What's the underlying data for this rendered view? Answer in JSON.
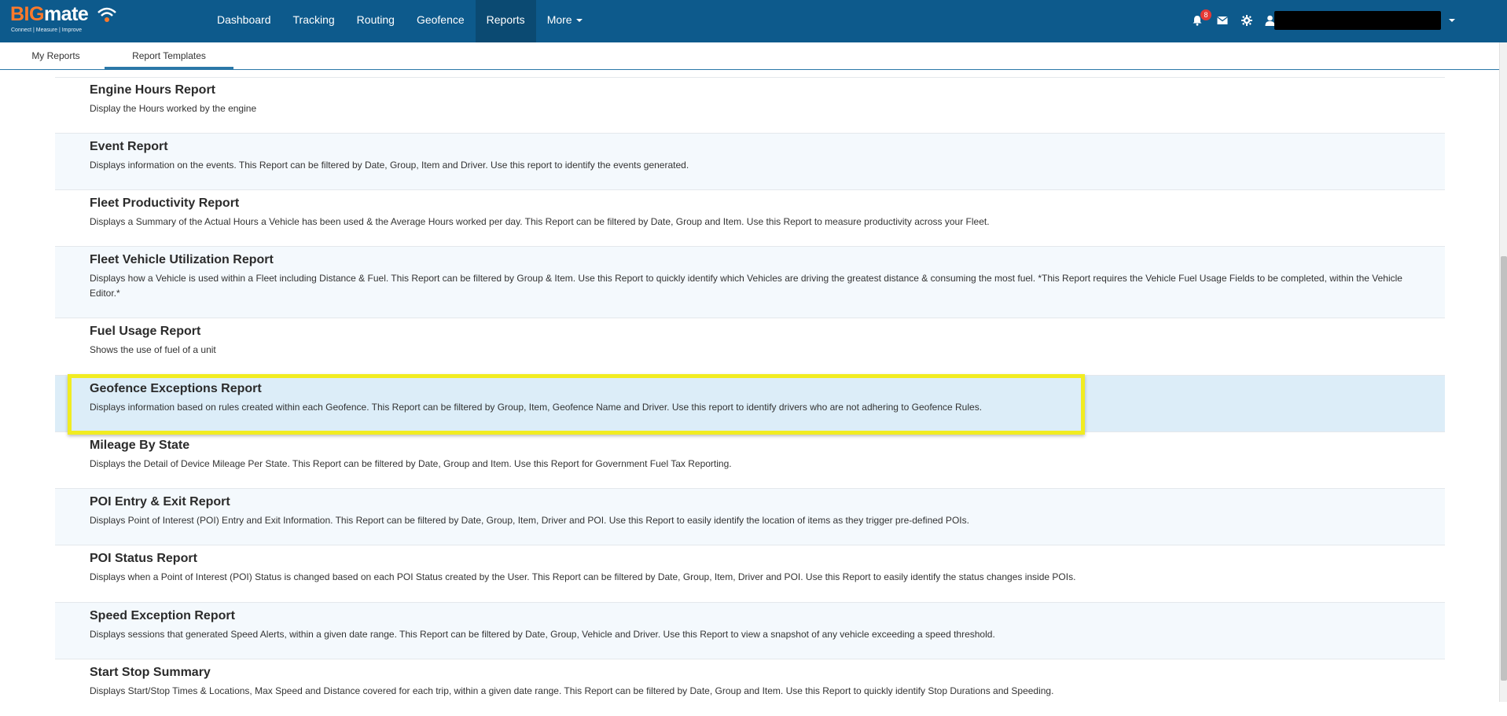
{
  "brand": {
    "logo_big": "BIG",
    "logo_mate": "mate",
    "tagline": "Connect | Measure | Improve"
  },
  "nav": {
    "items": [
      "Dashboard",
      "Tracking",
      "Routing",
      "Geofence",
      "Reports",
      "More"
    ],
    "active": "Reports",
    "notification_count": "8"
  },
  "subtabs": {
    "my_reports": "My Reports",
    "report_templates": "Report Templates",
    "active": "Report Templates"
  },
  "reports": [
    {
      "title": "Engine Hours Report",
      "desc": "Display the Hours worked by the engine"
    },
    {
      "title": "Event Report",
      "desc": "Displays information on the events. This Report can be filtered by Date, Group, Item and Driver. Use this report to identify the events generated."
    },
    {
      "title": "Fleet Productivity Report",
      "desc": "Displays a Summary of the Actual Hours a Vehicle has been used & the Average Hours worked per day. This Report can be filtered by Date, Group and Item. Use this Report to measure productivity across your Fleet."
    },
    {
      "title": "Fleet Vehicle Utilization Report",
      "desc": "Displays how a Vehicle is used within a Fleet including Distance & Fuel. This Report can be filtered by Group & Item. Use this Report to quickly identify which Vehicles are driving the greatest distance & consuming the most fuel. *This Report requires the Vehicle Fuel Usage Fields to be completed, within the Vehicle Editor.*"
    },
    {
      "title": "Fuel Usage Report",
      "desc": "Shows the use of fuel of a unit"
    },
    {
      "title": "Geofence Exceptions Report",
      "desc": "Displays information based on rules created within each Geofence. This Report can be filtered by Group, Item, Geofence Name and Driver. Use this report to identify drivers who are not adhering to Geofence Rules."
    },
    {
      "title": "Mileage By State",
      "desc": "Displays the Detail of Device Mileage Per State. This Report can be filtered by Date, Group and Item. Use this Report for Government Fuel Tax Reporting."
    },
    {
      "title": "POI Entry & Exit Report",
      "desc": "Displays Point of Interest (POI) Entry and Exit Information. This Report can be filtered by Date, Group, Item, Driver and POI. Use this Report to easily identify the location of items as they trigger pre-defined POIs."
    },
    {
      "title": "POI Status Report",
      "desc": "Displays when a Point of Interest (POI) Status is changed based on each POI Status created by the User. This Report can be filtered by Date, Group, Item, Driver and POI. Use this Report to easily identify the status changes inside POIs."
    },
    {
      "title": "Speed Exception Report",
      "desc": "Displays sessions that generated Speed Alerts, within a given date range. This Report can be filtered by Date, Group, Vehicle and Driver. Use this Report to view a snapshot of any vehicle exceeding a speed threshold."
    },
    {
      "title": "Start Stop Summary",
      "desc": "Displays Start/Stop Times & Locations, Max Speed and Distance covered for each trip, within a given date range. This Report can be filtered by Date, Group and Item. Use this Report to quickly identify Stop Durations and Speeding."
    }
  ],
  "highlighted_report": "Geofence Exceptions Report",
  "colors": {
    "navbar": "#0d5a8c",
    "nav_active": "#0b4a72",
    "brand_orange": "#ff7a2b",
    "highlight": "#f1ec21",
    "row_alt": "#f4f9fd",
    "row_selected": "#dcedf8"
  }
}
